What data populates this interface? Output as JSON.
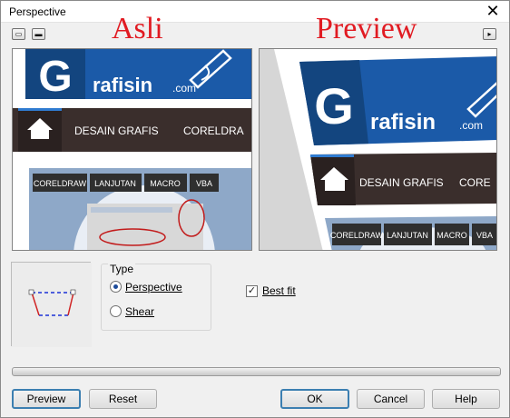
{
  "window": {
    "title": "Perspective",
    "close_glyph": "✕"
  },
  "toolbar": {
    "btn1_icon": "restore-icon",
    "btn2_icon": "minimize-icon",
    "preview_toggle_icon": "play-arrow-icon"
  },
  "headers": {
    "left": "Asli",
    "right": "Preview"
  },
  "site": {
    "logo_g": "G",
    "logo_text": "rafisin",
    "logo_suffix": ".com",
    "nav": [
      "DESAIN GRAFIS",
      "CORELDRA"
    ],
    "nav_preview": [
      "DESAIN GRAFIS",
      "CORE"
    ],
    "tags": [
      "CORELDRAW",
      "LANJUTAN",
      "MACRO",
      "VBA"
    ]
  },
  "type_group": {
    "legend": "Type",
    "options": [
      {
        "label": "Perspective",
        "selected": true
      },
      {
        "label": "Shear",
        "selected": false
      }
    ]
  },
  "best_fit": {
    "label": "Best fit",
    "checked": true
  },
  "buttons": {
    "preview": "Preview",
    "reset": "Reset",
    "ok": "OK",
    "cancel": "Cancel",
    "help": "Help"
  },
  "progress": {
    "value": 0
  },
  "colors": {
    "accent_red": "#e11b22",
    "brand_blue": "#1b5aa8",
    "nav_dark": "#3a2e2c"
  }
}
